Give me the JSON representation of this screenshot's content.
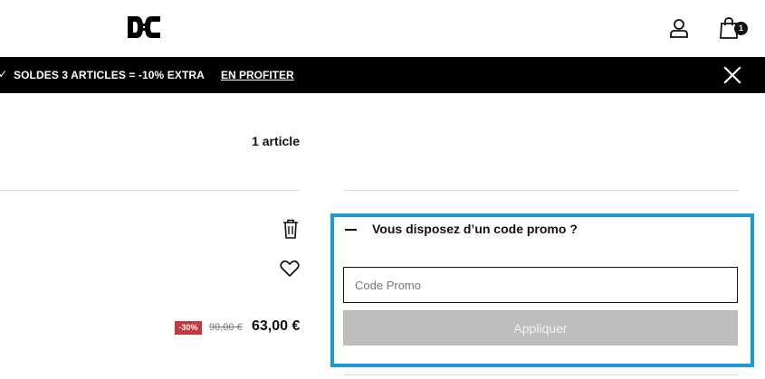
{
  "header": {
    "logo_icon": "dc-shoes-logo-icon",
    "account_icon": "user-icon",
    "cart_icon": "shopping-bag-icon",
    "cart_count": "1"
  },
  "banner": {
    "text": "SOLDES  3 ARTICLES = -10% EXTRA",
    "link_label": "EN PROFITER",
    "close_icon": "close-icon",
    "background": "#000000"
  },
  "cart": {
    "article_count": "1 article",
    "item": {
      "delete_icon": "trash-icon",
      "wishlist_icon": "heart-icon",
      "discount": "-30%",
      "original_price": "90,00 €",
      "price": "63,00 €"
    }
  },
  "promo": {
    "title": "Vous disposez d’un code promo ?",
    "input_value": "",
    "input_placeholder": "Code Promo",
    "apply_label": "Appliquer",
    "highlight_color": "#1b9ad6"
  }
}
